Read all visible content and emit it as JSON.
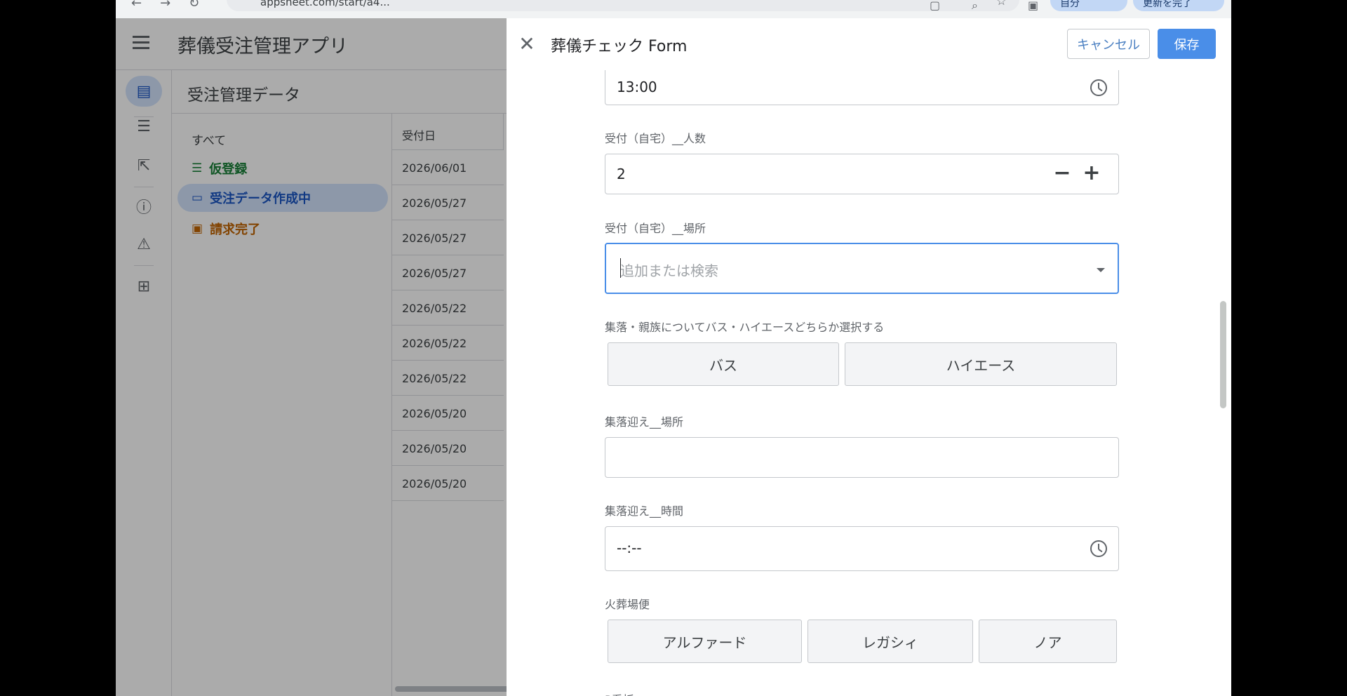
{
  "browser": {
    "url_text": "appsheet.com/start/a4...",
    "extension_label": "自分",
    "update_label": "更新を完了"
  },
  "app": {
    "title": "葬儀受注管理アプリ",
    "view_title": "受注管理データ",
    "filters": {
      "all": "すべて",
      "temp": "仮登録",
      "creating": "受注データ作成中",
      "billed": "請求完了"
    },
    "table": {
      "column_header": "受付日",
      "rows": [
        "2026/06/01",
        "2026/05/27",
        "2026/05/27",
        "2026/05/27",
        "2026/05/22",
        "2026/05/22",
        "2026/05/22",
        "2026/05/20",
        "2026/05/20",
        "2026/05/20"
      ]
    }
  },
  "form": {
    "title": "葬儀チェック Form",
    "cancel_label": "キャンセル",
    "save_label": "保存",
    "time_value": "13:00",
    "count_label": "受付（自宅）__人数",
    "count_value": "2",
    "place_label": "受付（自宅）__場所",
    "place_placeholder": "追加または検索",
    "transport_label": "集落・親族についてバス・ハイエースどちらか選択する",
    "transport_options": [
      "バス",
      "ハイエース"
    ],
    "pickup_place_label": "集落迎え__場所",
    "pickup_place_value": "",
    "pickup_time_label": "集落迎え__時間",
    "pickup_time_value": "--:--",
    "crematorium_label": "火葬場便",
    "crematorium_options": [
      "アルファード",
      "レガシィ",
      "ノア"
    ],
    "next_label_partial": "P看板"
  },
  "colors": {
    "primary": "#4a8ee8",
    "green": "#188038",
    "blue": "#1a56c4",
    "orange": "#c26401"
  }
}
